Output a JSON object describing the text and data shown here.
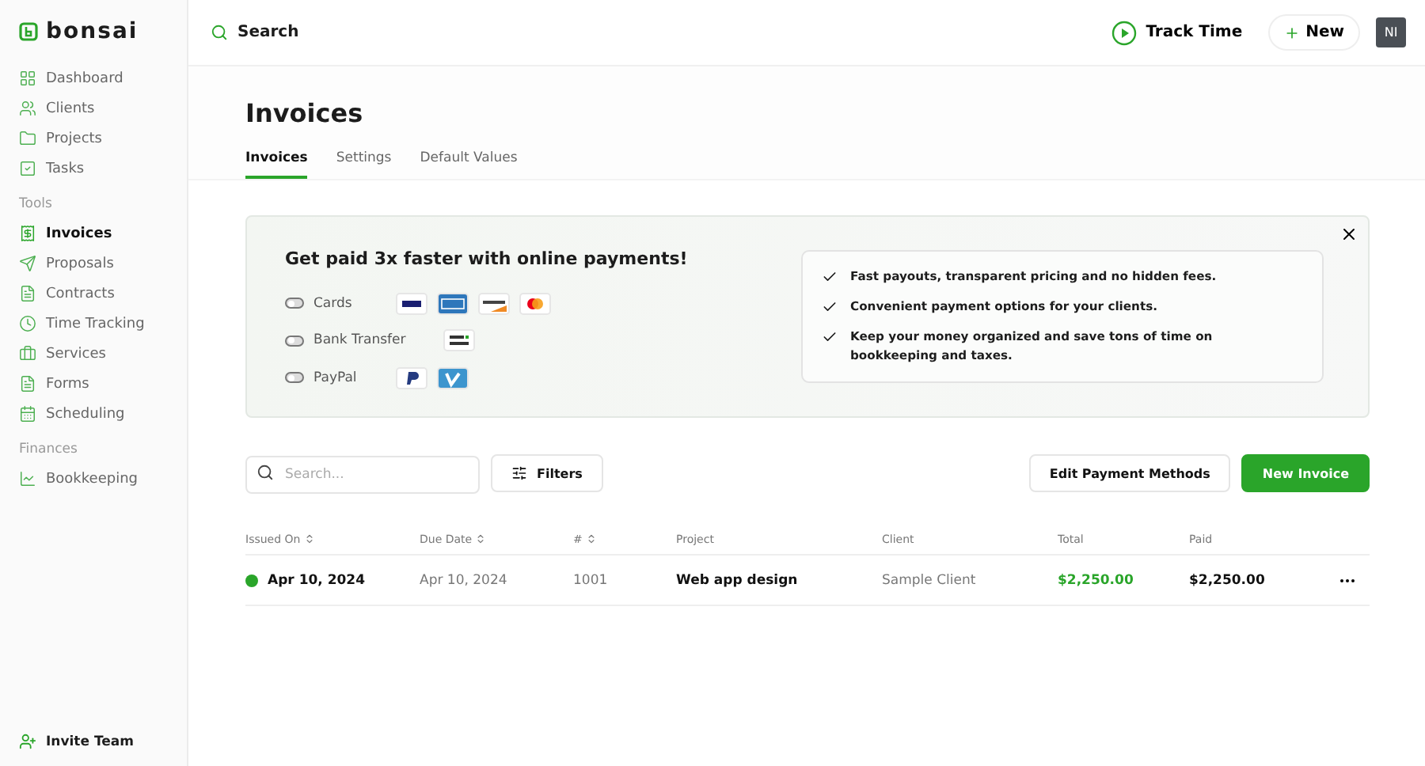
{
  "brand": "bonsai",
  "sidebar": {
    "items": [
      {
        "label": "Dashboard",
        "selected": false
      },
      {
        "label": "Clients",
        "selected": false
      },
      {
        "label": "Projects",
        "selected": false
      },
      {
        "label": "Tasks",
        "selected": false
      }
    ],
    "sections": [
      {
        "title": "Tools",
        "items": [
          {
            "label": "Invoices",
            "selected": true
          },
          {
            "label": "Proposals",
            "selected": false
          },
          {
            "label": "Contracts",
            "selected": false
          },
          {
            "label": "Time Tracking",
            "selected": false
          },
          {
            "label": "Services",
            "selected": false
          },
          {
            "label": "Forms",
            "selected": false
          },
          {
            "label": "Scheduling",
            "selected": false
          }
        ]
      },
      {
        "title": "Finances",
        "items": [
          {
            "label": "Bookkeeping",
            "selected": false
          }
        ]
      }
    ],
    "footer": [
      {
        "label": "Invite Team"
      }
    ]
  },
  "topbar": {
    "search": "Search",
    "track_time": "Track Time",
    "new": "New",
    "avatar": "NI"
  },
  "page": {
    "title": "Invoices",
    "tabs": [
      {
        "label": "Invoices",
        "selected": true
      },
      {
        "label": "Settings",
        "selected": false
      },
      {
        "label": "Default Values",
        "selected": false
      }
    ]
  },
  "banner": {
    "title": "Get paid 3x faster with online payments!",
    "methods": [
      {
        "label": "Cards",
        "on": false
      },
      {
        "label": "Bank Transfer",
        "on": false
      },
      {
        "label": "PayPal",
        "on": false
      }
    ],
    "benefits": [
      "Fast payouts, transparent pricing and no hidden fees.",
      "Convenient payment options for your clients.",
      "Keep your money organized and save tons of time on bookkeeping and taxes."
    ]
  },
  "toolbar": {
    "search_placeholder": "Search...",
    "filters": "Filters",
    "edit_payment_methods": "Edit Payment Methods",
    "new_invoice": "New Invoice"
  },
  "table": {
    "columns": [
      {
        "label": "Issued On",
        "sortable": true
      },
      {
        "label": "Due Date",
        "sortable": true
      },
      {
        "label": "#",
        "sortable": true
      },
      {
        "label": "Project",
        "sortable": false
      },
      {
        "label": "Client",
        "sortable": false
      },
      {
        "label": "Total",
        "sortable": false
      },
      {
        "label": "Paid",
        "sortable": false
      }
    ],
    "rows": [
      {
        "color": "#2aa52a",
        "cells": [
          "Apr 10, 2024",
          "Apr 10, 2024",
          "1001",
          "Web app design",
          "Sample Client",
          "$2,250.00",
          "$2,250.00"
        ]
      }
    ]
  }
}
